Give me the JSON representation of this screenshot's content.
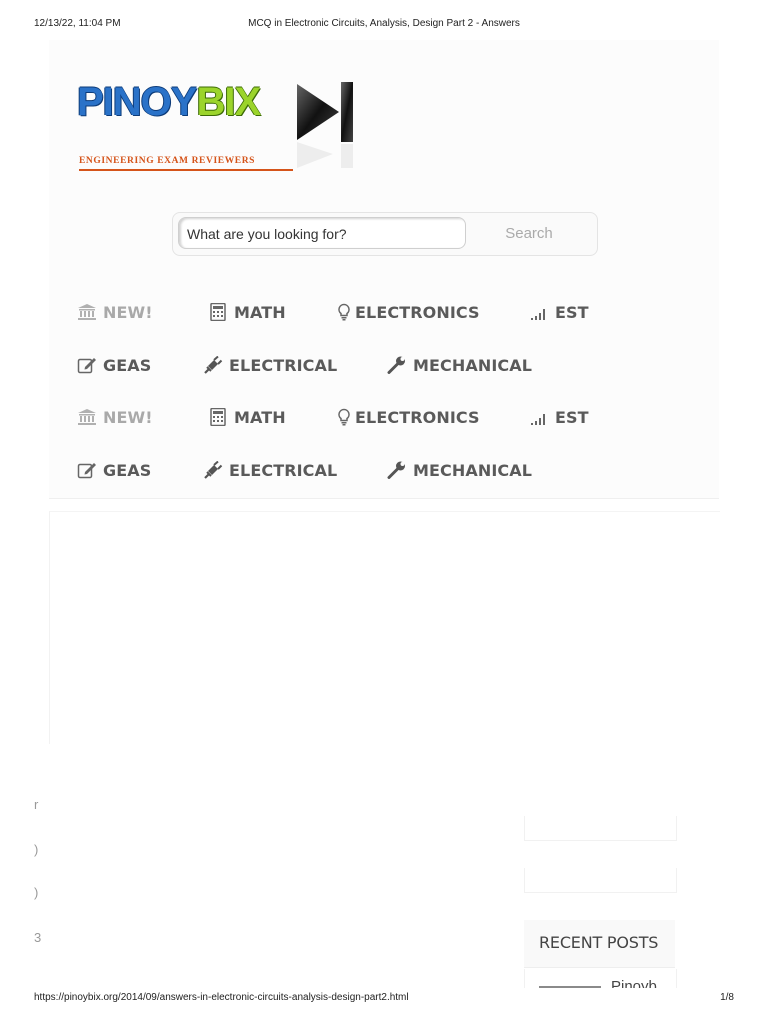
{
  "print_header": {
    "datetime": "12/13/22, 11:04 PM",
    "title": "MCQ in Electronic Circuits, Analysis, Design Part 2 - Answers"
  },
  "logo": {
    "wordmark_part1": "PINOY",
    "wordmark_part2": "BIX",
    "tagline": "ENGINEERING EXAM REVIEWERS",
    "colors": {
      "blue": "#2a72c8",
      "green": "#9bd42b",
      "orange": "#d5541a"
    }
  },
  "search": {
    "placeholder": "What are you looking for?",
    "button_label": "Search"
  },
  "nav": {
    "rows": [
      [
        {
          "label": "NEW!",
          "icon": "bank-icon",
          "muted": true
        },
        {
          "label": "MATH",
          "icon": "calculator-icon"
        },
        {
          "label": "ELECTRONICS",
          "icon": "lightbulb-icon"
        },
        {
          "label": "EST",
          "icon": "signal-icon"
        }
      ],
      [
        {
          "label": "GEAS",
          "icon": "edit-icon"
        },
        {
          "label": "ELECTRICAL",
          "icon": "plug-icon"
        },
        {
          "label": "MECHANICAL",
          "icon": "wrench-icon"
        }
      ],
      [
        {
          "label": "NEW!",
          "icon": "bank-icon",
          "muted": true
        },
        {
          "label": "MATH",
          "icon": "calculator-icon"
        },
        {
          "label": "ELECTRONICS",
          "icon": "lightbulb-icon"
        },
        {
          "label": "EST",
          "icon": "signal-icon"
        }
      ],
      [
        {
          "label": "GEAS",
          "icon": "edit-icon"
        },
        {
          "label": "ELECTRICAL",
          "icon": "plug-icon"
        },
        {
          "label": "MECHANICAL",
          "icon": "wrench-icon"
        }
      ]
    ]
  },
  "left_edge_glyphs": [
    "r",
    ")",
    ")",
    "3"
  ],
  "sidebar": {
    "recent_posts_title": "RECENT POSTS",
    "recent_item_text": "Pinoyb"
  },
  "print_footer": {
    "url": "https://pinoybix.org/2014/09/answers-in-electronic-circuits-analysis-design-part2.html",
    "page": "1/8"
  }
}
